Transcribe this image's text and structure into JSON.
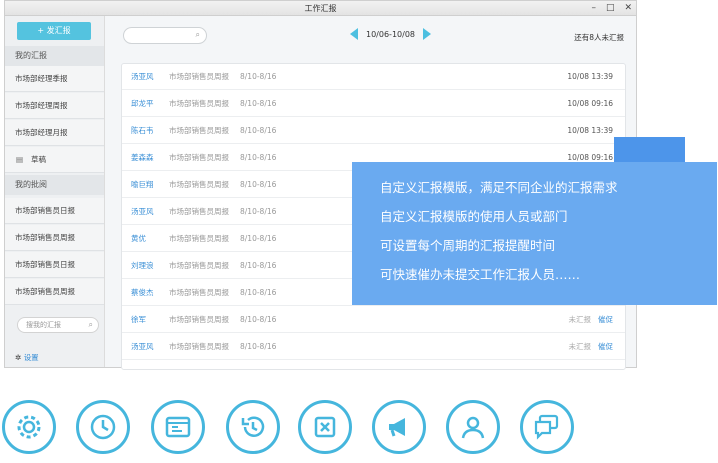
{
  "window": {
    "title": "工作汇报",
    "controls": [
      "–",
      "□",
      "✕"
    ]
  },
  "sidebar": {
    "new_button": "+ 发汇报",
    "my_reports": {
      "label": "我的汇报",
      "items": [
        "市场部经理季报",
        "市场部经理周报",
        "市场部经理月报",
        "草稿"
      ]
    },
    "my_approvals": {
      "label": "我的批阅",
      "items": [
        "市场部销售员日报",
        "市场部销售员周报",
        "市场部销售员日报",
        "市场部销售员周报"
      ]
    },
    "search_placeholder": "搜我的汇报",
    "settings_label": "设置"
  },
  "header": {
    "date_range": "10/06-10/08",
    "pending_text": "还有8人未汇报"
  },
  "reports": [
    {
      "name": "汤亚风",
      "type": "市场部销售员周报",
      "date": "8/10-8/16",
      "time": "10/08 13:39"
    },
    {
      "name": "邱龙平",
      "type": "市场部销售员周报",
      "date": "8/10-8/16",
      "time": "10/08 09:16"
    },
    {
      "name": "陈石韦",
      "type": "市场部销售员周报",
      "date": "8/10-8/16",
      "time": "10/08 13:39"
    },
    {
      "name": "姜森森",
      "type": "市场部销售员周报",
      "date": "8/10-8/16",
      "time": "10/08 09:16"
    },
    {
      "name": "喻巨翔",
      "type": "市场部销售员周报",
      "date": "8/10-8/16",
      "time": ""
    },
    {
      "name": "汤亚风",
      "type": "市场部销售员周报",
      "date": "8/10-8/16",
      "time": ""
    },
    {
      "name": "黄优",
      "type": "市场部销售员周报",
      "date": "8/10-8/16",
      "time": ""
    },
    {
      "name": "刘理浪",
      "type": "市场部销售员周报",
      "date": "8/10-8/16",
      "time": ""
    },
    {
      "name": "蔡俊杰",
      "type": "市场部销售员周报",
      "date": "8/10-8/16",
      "time": ""
    },
    {
      "name": "徐军",
      "type": "市场部销售员周报",
      "date": "8/10-8/16",
      "status": "未汇报",
      "remind": "催促"
    },
    {
      "name": "汤亚风",
      "type": "市场部销售员周报",
      "date": "8/10-8/16",
      "status": "未汇报",
      "remind": "催促"
    }
  ],
  "popup": {
    "lines": [
      "自定义汇报模版，满足不同企业的汇报需求",
      "自定义汇报模版的使用人员或部门",
      "可设置每个周期的汇报提醒时间",
      "可快速催办未提交工作汇报人员……"
    ]
  },
  "bottom_icons": [
    "gear-icon",
    "clock-icon",
    "window-icon",
    "history-icon",
    "close-box-icon",
    "megaphone-icon",
    "user-icon",
    "chat-icon"
  ],
  "colors": {
    "accent": "#45b6dd",
    "link": "#3a8fd6",
    "popup": "#6aaaf0"
  }
}
